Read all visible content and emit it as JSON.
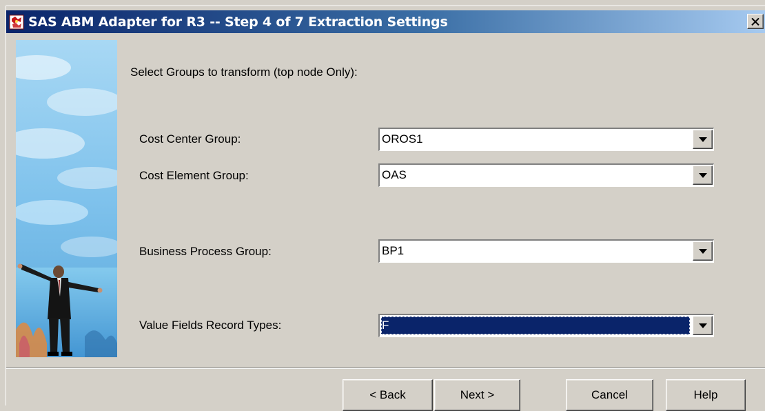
{
  "window": {
    "title": "SAS ABM Adapter for R3  -- Step 4 of 7  Extraction Settings",
    "close_label": "✕"
  },
  "main": {
    "heading": "Select Groups to transform (top node Only):",
    "fields": [
      {
        "label": "Cost Center Group:",
        "value": "OROS1"
      },
      {
        "label": "Cost Element Group:",
        "value": "OAS"
      },
      {
        "label": "Business Process Group:",
        "value": "BP1"
      },
      {
        "label": "Value Fields Record Types:",
        "value": "F"
      }
    ]
  },
  "buttons": {
    "back": "< Back",
    "next": "Next >",
    "cancel": "Cancel",
    "help": "Help"
  },
  "colors": {
    "titlebar_start": "#0a246a",
    "titlebar_end": "#a6caf0",
    "dialog_bg": "#d4d0c8",
    "selection": "#0a246a"
  },
  "icons": {
    "title": "sas-app-icon",
    "close": "close-icon",
    "dropdown": "chevron-down-icon"
  }
}
